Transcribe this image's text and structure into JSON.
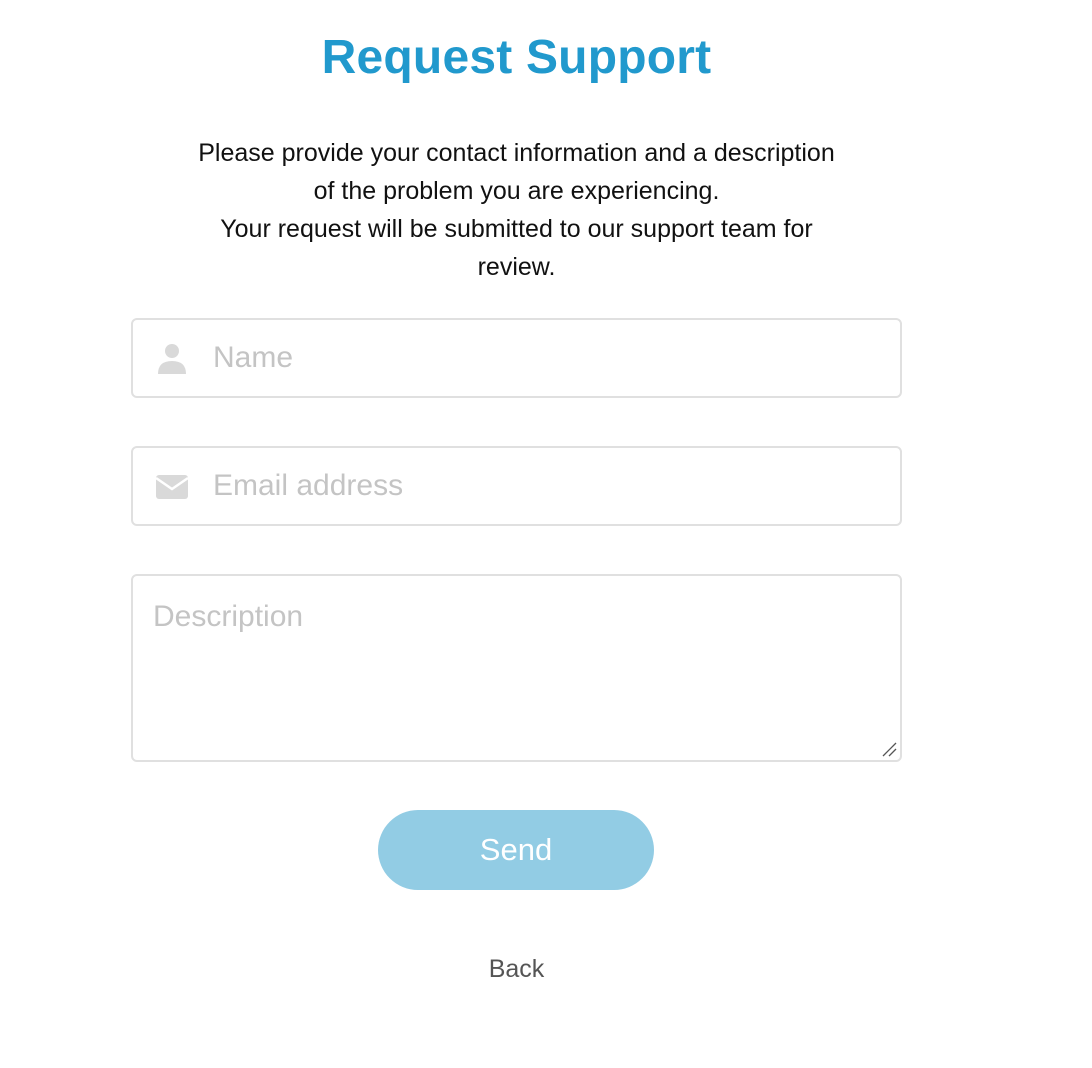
{
  "page": {
    "title": "Request Support",
    "intro_lines": [
      "Please provide your contact information and a description",
      "of the problem you are experiencing.",
      "Your request will be submitted to our support team for",
      "review."
    ]
  },
  "form": {
    "name": {
      "placeholder": "Name",
      "value": "",
      "icon": "user-icon"
    },
    "email": {
      "placeholder": "Email address",
      "value": "",
      "icon": "envelope-icon"
    },
    "description": {
      "placeholder": "Description",
      "value": ""
    },
    "send_label": "Send",
    "back_label": "Back"
  },
  "colors": {
    "title": "#2199cd",
    "button": "#92cce4",
    "field_border": "#e0e0e0",
    "icon": "#d9d9d9",
    "placeholder": "#c4c4c4"
  }
}
